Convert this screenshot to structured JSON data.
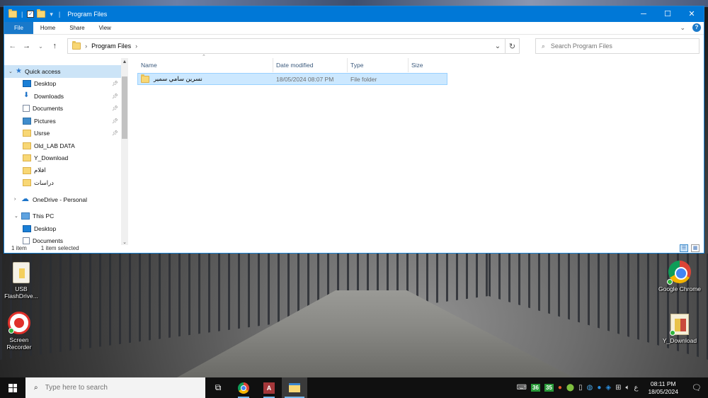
{
  "window": {
    "title": "Program Files",
    "controls": {
      "minimize": "─",
      "maximize": "☐",
      "close": "✕"
    }
  },
  "ribbon": {
    "tabs": [
      "File",
      "Home",
      "Share",
      "View"
    ],
    "help": "?"
  },
  "address": {
    "path": "Program Files",
    "search_placeholder": "Search Program Files"
  },
  "navpane": {
    "quick_access": "Quick access",
    "items": [
      {
        "label": "Desktop",
        "pinned": true
      },
      {
        "label": "Downloads",
        "pinned": true
      },
      {
        "label": "Documents",
        "pinned": true
      },
      {
        "label": "Pictures",
        "pinned": true
      },
      {
        "label": "Usrse",
        "pinned": true
      },
      {
        "label": "Old_LAB DATA",
        "pinned": false
      },
      {
        "label": "Y_Download",
        "pinned": false
      },
      {
        "label": "افلام",
        "pinned": false
      },
      {
        "label": "دراسات",
        "pinned": false
      }
    ],
    "onedrive": "OneDrive - Personal",
    "thispc": "This PC",
    "thispc_items": [
      "Desktop",
      "Documents"
    ]
  },
  "columns": {
    "name": "Name",
    "date": "Date modified",
    "type": "Type",
    "size": "Size"
  },
  "files": [
    {
      "name": "نسرين سامي سمير",
      "date": "18/05/2024 08:07 PM",
      "type": "File folder",
      "size": ""
    }
  ],
  "status": {
    "count": "1 item",
    "selected": "1 item selected"
  },
  "desktop_icons": {
    "usb": "USB FlashDrive...",
    "recorder": "Screen Recorder",
    "chrome": "Google Chrome",
    "ydownload": "Y_Download"
  },
  "taskbar": {
    "search_placeholder": "Type here to search",
    "tray_num1": "36",
    "tray_num2": "35",
    "lang": "ع",
    "time": "08:11 PM",
    "date": "18/05/2024"
  },
  "colors": {
    "accent": "#0078d7",
    "selection": "#cce8ff",
    "taskbar": "#101010"
  }
}
